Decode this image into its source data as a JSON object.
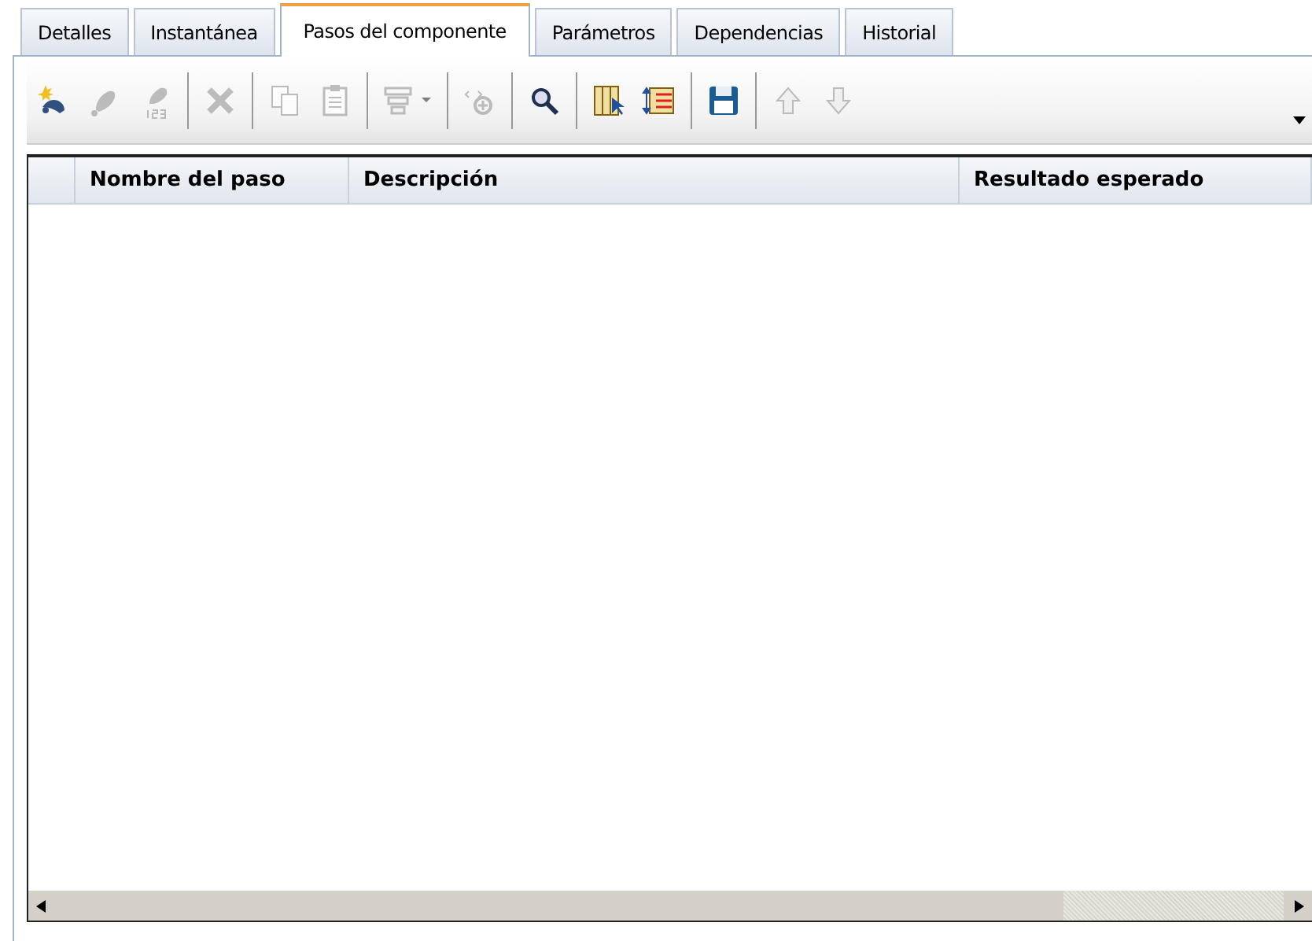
{
  "tabs": [
    {
      "label": "Detalles",
      "selected": false
    },
    {
      "label": "Instantánea",
      "selected": false
    },
    {
      "label": "Pasos del componente",
      "selected": true
    },
    {
      "label": "Parámetros",
      "selected": false
    },
    {
      "label": "Dependencias",
      "selected": false
    },
    {
      "label": "Historial",
      "selected": false
    }
  ],
  "toolbar": [
    {
      "kind": "button",
      "disabled": false
    },
    {
      "kind": "button",
      "disabled": true
    },
    {
      "kind": "button",
      "disabled": true
    },
    {
      "kind": "separator"
    },
    {
      "kind": "button",
      "disabled": true
    },
    {
      "kind": "separator"
    },
    {
      "kind": "button",
      "disabled": true
    },
    {
      "kind": "button",
      "disabled": true
    },
    {
      "kind": "separator"
    },
    {
      "kind": "dropdown",
      "disabled": true
    },
    {
      "kind": "separator"
    },
    {
      "kind": "button",
      "disabled": true
    },
    {
      "kind": "separator"
    },
    {
      "kind": "button",
      "disabled": false
    },
    {
      "kind": "separator"
    },
    {
      "kind": "button",
      "disabled": false
    },
    {
      "kind": "button",
      "disabled": false
    },
    {
      "kind": "separator"
    },
    {
      "kind": "button",
      "disabled": false
    },
    {
      "kind": "separator"
    },
    {
      "kind": "button",
      "disabled": true
    },
    {
      "kind": "button",
      "disabled": true
    }
  ],
  "table": {
    "columns": [
      "Nombre del paso",
      "Descripción",
      "Resultado esperado"
    ]
  }
}
